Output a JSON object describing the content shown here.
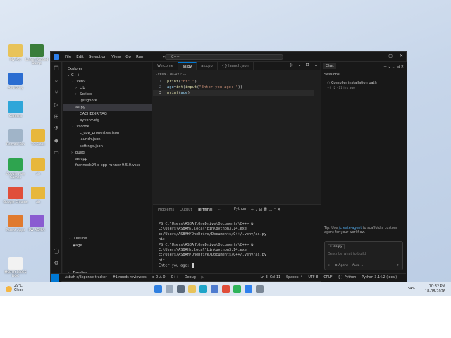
{
  "desktop": {
    "icons": [
      {
        "label": "My Pcs",
        "color": "#e8c35a"
      },
      {
        "label": "Canon Padded Dump",
        "color": "#3a7d3a"
      },
      {
        "label": "Androshy",
        "color": "#2b6dd1"
      },
      {
        "label": "Camera",
        "color": "#2fa6d9"
      },
      {
        "label": "Recycle Bin",
        "color": "#a0b4c8"
      },
      {
        "label": "TS Class",
        "color": "#e7b73c"
      },
      {
        "label": "Google Play Games",
        "color": "#2ea44f"
      },
      {
        "label": "ab",
        "color": "#e7b73c"
      },
      {
        "label": "Google Chrome",
        "color": "#e04e3a"
      },
      {
        "label": "ab",
        "color": "#e7b73c"
      },
      {
        "label": "Parent Apps",
        "color": "#e07a2e"
      },
      {
        "label": "PW ASMIA",
        "color": "#8a5cd1"
      },
      {
        "label": "MSRTD PERFS DOC",
        "color": "#f2f2f2"
      }
    ]
  },
  "window": {
    "menu": [
      "File",
      "Edit",
      "Selection",
      "View",
      "Go",
      "Run"
    ],
    "nav_arrows": "← →",
    "search_text": "C++",
    "win_controls": [
      "—",
      "▢",
      "✕"
    ]
  },
  "explorer": {
    "header": "Explorer",
    "items": [
      {
        "label": "C++",
        "chev": "⌄",
        "indent": 0
      },
      {
        "label": ".venv",
        "chev": "⌄",
        "indent": 1
      },
      {
        "label": "Lib",
        "chev": "›",
        "indent": 2
      },
      {
        "label": "Scripts",
        "chev": "›",
        "indent": 2
      },
      {
        "label": ".gitignore",
        "chev": "",
        "indent": 2
      },
      {
        "label": "as.py",
        "chev": "",
        "indent": 1,
        "selected": true
      },
      {
        "label": "CACHEDIR.TAG",
        "chev": "",
        "indent": 2
      },
      {
        "label": "pyvenv.cfg",
        "chev": "",
        "indent": 2
      },
      {
        "label": ".vscode",
        "chev": "⌄",
        "indent": 1
      },
      {
        "label": "c_cpp_properties.json",
        "chev": "",
        "indent": 2
      },
      {
        "label": "launch.json",
        "chev": "",
        "indent": 2
      },
      {
        "label": "settings.json",
        "chev": "",
        "indent": 2
      },
      {
        "label": "build",
        "chev": "›",
        "indent": 1
      },
      {
        "label": "as.cpp",
        "chev": "",
        "indent": 1
      },
      {
        "label": "franneck94.c-cpp-runner-9.5.0.vsix",
        "chev": "",
        "indent": 1
      }
    ],
    "outline_header": "Outline",
    "outline_items": [
      "age"
    ],
    "timeline_header": "Timeline"
  },
  "editor": {
    "tabs": [
      {
        "label": "Welcome",
        "active": false
      },
      {
        "label": "as.py",
        "active": true
      },
      {
        "label": "as.cpp",
        "active": false
      },
      {
        "label": "{ } launch.json",
        "active": false
      }
    ],
    "tab_actions": "▷ ⌄ ⊟ …",
    "breadcrumb": ".venv › as.py › ...",
    "lines": [
      {
        "n": "1",
        "parts": [
          [
            "fn",
            "print"
          ],
          [
            "d",
            "("
          ],
          [
            "str",
            "\"hi: \""
          ],
          [
            "d",
            ")"
          ]
        ]
      },
      {
        "n": "2",
        "parts": [
          [
            "var",
            "age"
          ],
          [
            "d",
            "="
          ],
          [
            "fn",
            "int"
          ],
          [
            "d",
            "("
          ],
          [
            "fn",
            "input"
          ],
          [
            "d",
            "("
          ],
          [
            "str",
            "\"Enter you age: \""
          ],
          [
            "d",
            "))"
          ]
        ]
      },
      {
        "n": "3",
        "parts": [
          [
            "fn",
            "print"
          ],
          [
            "d",
            "("
          ],
          [
            "var",
            "age"
          ],
          [
            "d",
            ")"
          ]
        ],
        "current": true
      }
    ]
  },
  "panel": {
    "tabs": [
      {
        "label": "Problems",
        "active": false
      },
      {
        "label": "Output",
        "active": false
      },
      {
        "label": "Terminal",
        "active": true
      },
      {
        "label": "···",
        "active": false
      }
    ],
    "shell": "Python",
    "actions": "＋ ⌄ ⊟ 🗑 … ⌃ ✕",
    "terminal_lines": [
      "PS C:\\Users\\ASBAH\\OneDrive\\Documents\\C++> & C:\\Users\\ASBAH\\.local\\bin\\python3.14.exe c:/Users/ASBAH/OneDrive/Documents/C++/.venv/as.py",
      "hi:",
      "PS C:\\Users\\ASBAH\\OneDrive\\Documents\\C++> & C:\\Users\\ASBAH\\.local\\bin\\python3.14.exe c:/Users/ASBAH/OneDrive/Documents/C++/.venv/as.py",
      "hi:",
      "Enter you age: "
    ]
  },
  "chat": {
    "tab": "Chat",
    "sessions_header": "Sessions",
    "header_actions": "＋ ⌄ … ⊟ ✕",
    "session_title": "Compiler installation path",
    "session_meta": "+2 -2 · 11 hrs ago",
    "tip_prefix": "Tip: Use",
    "tip_link": "/create-agent",
    "tip_suffix": "to scaffold a custom agent for your workflow.",
    "context_chip": "as.py",
    "placeholder": "Describe what to build",
    "agent": "Agent",
    "auto": "Auto",
    "local": "Local",
    "permissions": "Default permissions"
  },
  "statusbar": {
    "items": [
      "Asbah-s/Expense-tracker",
      "#1 needs reviewers",
      "⊗ 0 ⚠ 0",
      "C++",
      "Debug",
      "▷",
      "Ln 3, Col 11",
      "Spaces: 4",
      "UTF-8",
      "CRLF",
      "{ } Python",
      "Python 3.14.2 (local)"
    ]
  },
  "taskbar": {
    "weather_temp": "29°C",
    "weather_desc": "Clear",
    "battery": "34%",
    "time": "10:32 PM",
    "date": "18-08-2026"
  }
}
